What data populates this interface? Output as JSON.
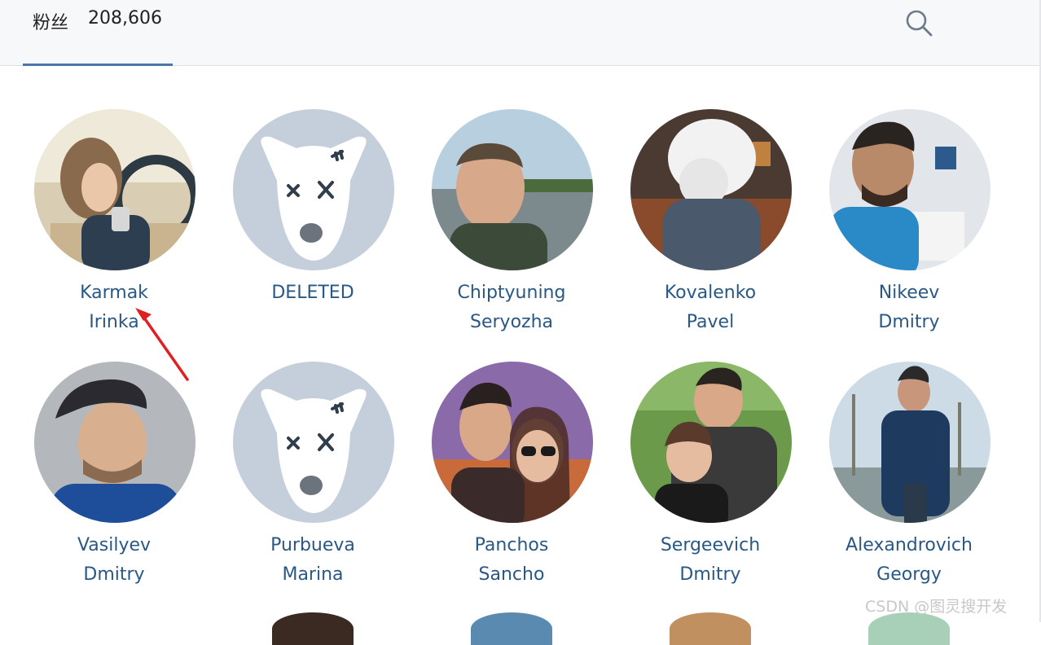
{
  "header": {
    "tab_label": "粉丝",
    "follower_count": "208,606",
    "search_icon": "search-icon"
  },
  "followers": [
    {
      "first": "Karmak",
      "last": "Irinka",
      "avatar": "photo"
    },
    {
      "first": "DELETED",
      "last": "",
      "avatar": "deleted-dog"
    },
    {
      "first": "Chiptyuning",
      "last": "Seryozha",
      "avatar": "photo"
    },
    {
      "first": "Kovalenko",
      "last": "Pavel",
      "avatar": "photo"
    },
    {
      "first": "Nikeev",
      "last": "Dmitry",
      "avatar": "photo"
    },
    {
      "first": "Vasilyev",
      "last": "Dmitry",
      "avatar": "photo"
    },
    {
      "first": "Purbueva",
      "last": "Marina",
      "avatar": "deleted-dog"
    },
    {
      "first": "Panchos",
      "last": "Sancho",
      "avatar": "photo"
    },
    {
      "first": "Sergeevich",
      "last": "Dmitry",
      "avatar": "photo"
    },
    {
      "first": "Alexandrovich",
      "last": "Georgy",
      "avatar": "photo"
    }
  ],
  "watermark": "CSDN @图灵搜开发",
  "colors": {
    "link": "#2a5885",
    "tab_underline": "#4a76a8",
    "deleted_avatar_bg": "#c5cfdc",
    "annotation_arrow": "#e02020"
  }
}
